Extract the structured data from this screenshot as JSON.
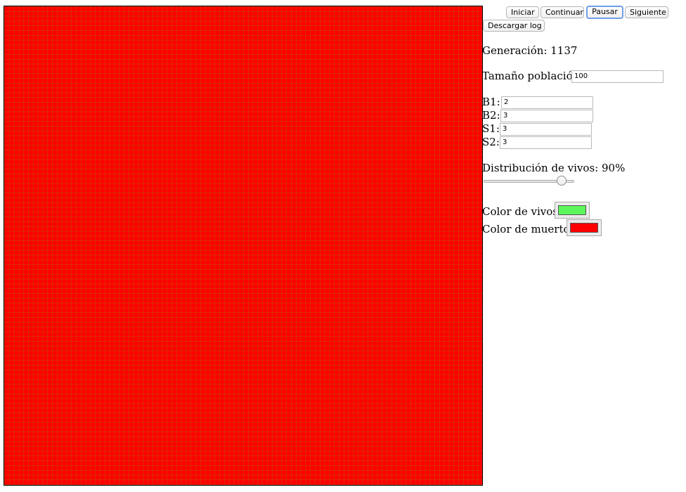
{
  "controls": {
    "start_label": "Iniciar",
    "continue_label": "Continuar",
    "pause_label": "Pausar",
    "next_label": "Siguiente",
    "download_log_label": "Descargar log"
  },
  "stats": {
    "generation_label": "Generación:",
    "generation_value": "1137"
  },
  "population": {
    "label": "Tamaño población:",
    "value": "100"
  },
  "rules": {
    "b1_label": "B1:",
    "b1_value": "2",
    "b2_label": "B2:",
    "b2_value": "3",
    "s1_label": "S1:",
    "s1_value": "3",
    "s2_label": "S2:",
    "s2_value": "3"
  },
  "distribution": {
    "label": "Distribución de vivos:",
    "value_text": "90%",
    "value": 90
  },
  "colors": {
    "alive_label": "Color de vivos:",
    "alive_color": "#5cf75c",
    "dead_label": "Color de muertos:",
    "dead_color": "#ff0000"
  }
}
